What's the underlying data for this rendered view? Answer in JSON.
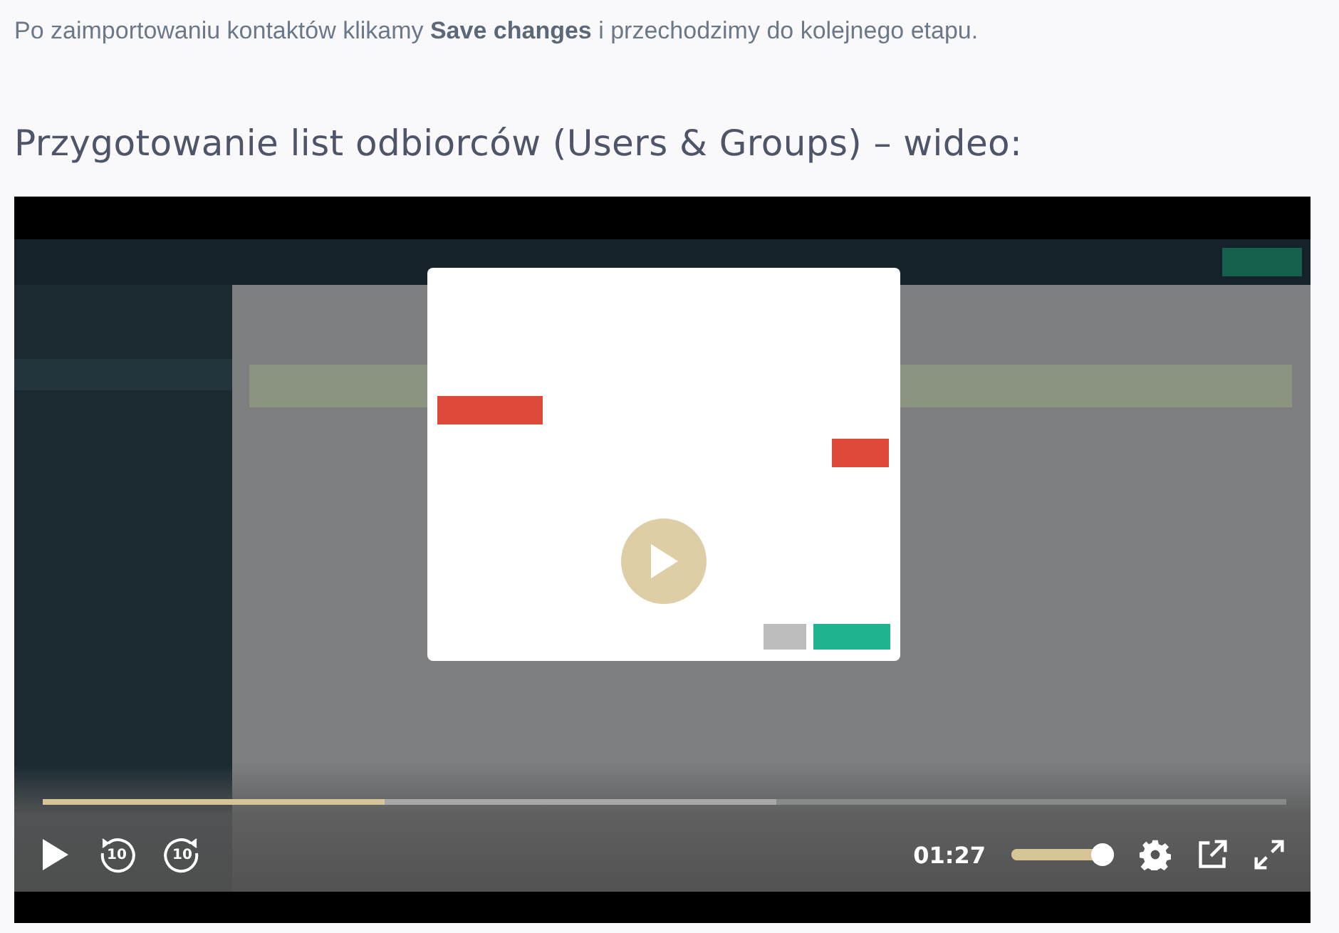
{
  "intro": {
    "text": "Po zaimportowaniu kontaktów klikamy **Save changes** i przechodzimy do kolejnego etapu."
  },
  "heading": "Przygotowanie list odbiorców (Users & Groups) – wideo:",
  "video": {
    "playing": false,
    "progress": {
      "level": 0.275
    },
    "buffered": {
      "level": 0.59
    },
    "skip_back": "10",
    "skip_forward": "10",
    "time": "01:27",
    "volume": {
      "level": 1
    }
  }
}
